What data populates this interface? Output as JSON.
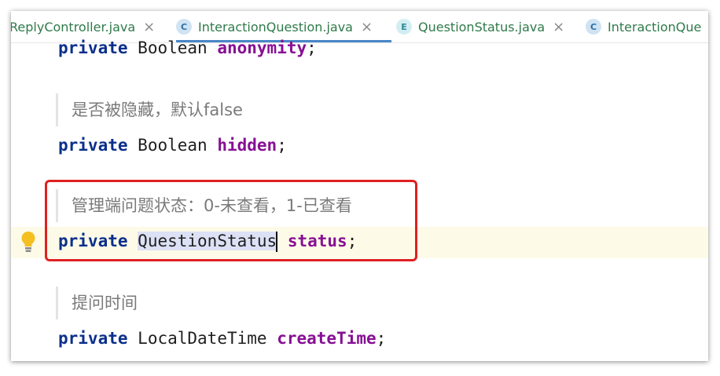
{
  "tabs": [
    {
      "icon": "C",
      "label": "ReplyController.java",
      "close": "×",
      "active": false
    },
    {
      "icon": "C",
      "label": "InteractionQuestion.java",
      "close": "×",
      "active": true
    },
    {
      "icon": "E",
      "label": "QuestionStatus.java",
      "close": "×",
      "active": false
    },
    {
      "icon": "C",
      "label": "InteractionQue",
      "close": "",
      "active": false
    }
  ],
  "code": {
    "line1": {
      "kw": "private",
      "type": "Boolean",
      "field": "anonymity",
      "end": ";"
    },
    "doc1": "是否被隐藏，默认false",
    "line2": {
      "kw": "private",
      "type": "Boolean",
      "field": "hidden",
      "end": ";"
    },
    "doc2": "管理端问题状态：0-未查看，1-已查看",
    "line3": {
      "kw": "private",
      "type": "QuestionStatus",
      "field": "status",
      "end": ";"
    },
    "doc3": "提问时间",
    "line4": {
      "kw": "private",
      "type": "LocalDateTime",
      "field": "createTime",
      "end": ";"
    }
  },
  "colors": {
    "keyword": "#0b2f8a",
    "field": "#871094",
    "highlight_box": "#e02020",
    "active_tab_underline": "#4a86c7"
  },
  "icons": {
    "class_icon": "class-icon",
    "enum_icon": "enum-icon",
    "gutter": "lightbulb-icon"
  }
}
